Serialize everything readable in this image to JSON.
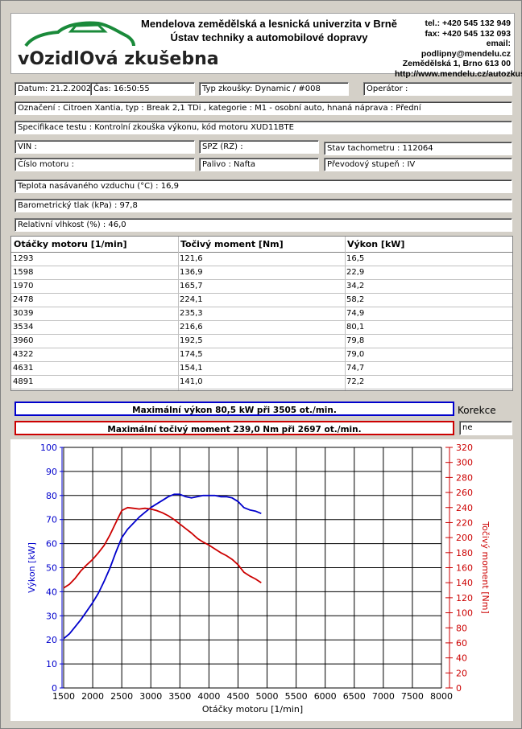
{
  "header": {
    "logo_text": "vOzidlOvá zkušebna",
    "university_line1": "Mendelova zemědělská a lesnická univerzita v Brně",
    "university_line2": "Ústav techniky a automobilové dopravy",
    "tel": "tel.: +420 545 132 949",
    "fax": "fax: +420 545 132 093",
    "email": "email: podlipny@mendelu.cz",
    "address": "Zemědělská 1, Brno 613 00",
    "web": "http://www.mendelu.cz/autozkusebna"
  },
  "fields": {
    "datum": "Datum: 21.2.2002",
    "cas": "Čas: 16:50:55",
    "typ_zkousky": "Typ zkoušky: Dynamic / #008",
    "operator": "Operátor :",
    "oznaceni": "Označení : Citroen Xantia, typ : Break 2,1 TDi , kategorie : M1 - osobní auto, hnaná náprava : Přední",
    "specifikace": "Specifikace testu : Kontrolní zkouška výkonu, kód motoru XUD11BTE",
    "vin": "VIN :",
    "spz": "SPZ (RZ) :",
    "stav_tachometru": "Stav tachometru : 112064",
    "cislo_motoru": "Číslo motoru :",
    "palivo": "Palivo : Nafta",
    "prevodovy_stupen": "Převodový stupeň : IV",
    "teplota": "Teplota nasávaného vzduchu (°C) : 16,9",
    "tlak": "Barometrický tlak (kPa) : 97,8",
    "vlhkost": "Relativní vlhkost (%) : 46,0"
  },
  "table": {
    "headers": [
      "Otáčky motoru [1/min]",
      "Točivý moment [Nm]",
      "Výkon [kW]"
    ],
    "rows": [
      [
        "1293",
        "121,6",
        "16,5"
      ],
      [
        "1598",
        "136,9",
        "22,9"
      ],
      [
        "1970",
        "165,7",
        "34,2"
      ],
      [
        "2478",
        "224,1",
        "58,2"
      ],
      [
        "3039",
        "235,3",
        "74,9"
      ],
      [
        "3534",
        "216,6",
        "80,1"
      ],
      [
        "3960",
        "192,5",
        "79,8"
      ],
      [
        "4322",
        "174,5",
        "79,0"
      ],
      [
        "4631",
        "154,1",
        "74,7"
      ],
      [
        "4891",
        "141,0",
        "72,2"
      ]
    ]
  },
  "max_power": "Maximální výkon 80,5 kW při 3505 ot./min.",
  "max_torque": "Maximální točivý moment 239,0 Nm při 2697 ot./min.",
  "korekce_label": "Korekce",
  "korekce_value": "ne",
  "colors": {
    "power": "#0000cc",
    "torque": "#cc0000",
    "background": "#d4d0c8"
  },
  "chart_data": {
    "type": "line",
    "xlabel": "Otáčky motoru [1/min]",
    "ylabel_left": "Výkon [kW]",
    "ylabel_right": "Točivý moment [Nm]",
    "xlim": [
      1500,
      8000
    ],
    "ylim_left": [
      0,
      100
    ],
    "ylim_right": [
      0,
      320
    ],
    "x_ticks": [
      "1500",
      "2000",
      "2500",
      "3000",
      "3500",
      "4000",
      "4500",
      "5000",
      "5500",
      "6000",
      "6500",
      "7000",
      "7500",
      "8000"
    ],
    "y_left_ticks": [
      "0",
      "10",
      "20",
      "30",
      "40",
      "50",
      "60",
      "70",
      "80",
      "90",
      "100"
    ],
    "y_right_ticks": [
      "0",
      "20",
      "40",
      "60",
      "80",
      "100",
      "120",
      "140",
      "160",
      "180",
      "200",
      "220",
      "240",
      "260",
      "280",
      "300",
      "320"
    ],
    "grid": true,
    "series": [
      {
        "name": "Výkon [kW]",
        "axis": "left",
        "color": "#0000cc",
        "x": [
          1500,
          1600,
          1700,
          1800,
          1900,
          2000,
          2100,
          2200,
          2300,
          2400,
          2500,
          2600,
          2700,
          2800,
          2900,
          3000,
          3100,
          3200,
          3300,
          3400,
          3500,
          3600,
          3700,
          3800,
          3900,
          4000,
          4100,
          4200,
          4300,
          4400,
          4500,
          4600,
          4700,
          4800,
          4900
        ],
        "y": [
          20.5,
          22.5,
          25.5,
          28.5,
          32.0,
          35.5,
          39.5,
          44.5,
          50.0,
          56.5,
          62.5,
          66.0,
          68.5,
          71.0,
          73.0,
          75.0,
          76.5,
          78.0,
          79.5,
          80.5,
          80.5,
          79.5,
          79.0,
          79.5,
          80.0,
          80.0,
          80.0,
          79.5,
          79.5,
          79.0,
          77.5,
          75.0,
          74.0,
          73.5,
          72.5
        ]
      },
      {
        "name": "Točivý moment [Nm]",
        "axis": "right",
        "color": "#cc0000",
        "x": [
          1500,
          1600,
          1700,
          1800,
          1900,
          2000,
          2100,
          2200,
          2300,
          2400,
          2500,
          2600,
          2700,
          2800,
          2900,
          3000,
          3100,
          3200,
          3300,
          3400,
          3500,
          3600,
          3700,
          3800,
          3900,
          4000,
          4100,
          4200,
          4300,
          4400,
          4500,
          4600,
          4700,
          4800,
          4900
        ],
        "y": [
          133,
          138,
          146,
          156,
          164,
          171,
          180,
          190,
          204,
          220,
          236,
          240,
          239,
          238,
          239,
          238,
          236,
          233,
          229,
          224,
          218,
          212,
          206,
          199,
          194,
          190,
          185,
          180,
          176,
          171,
          164,
          154,
          149,
          145,
          140
        ]
      }
    ]
  }
}
